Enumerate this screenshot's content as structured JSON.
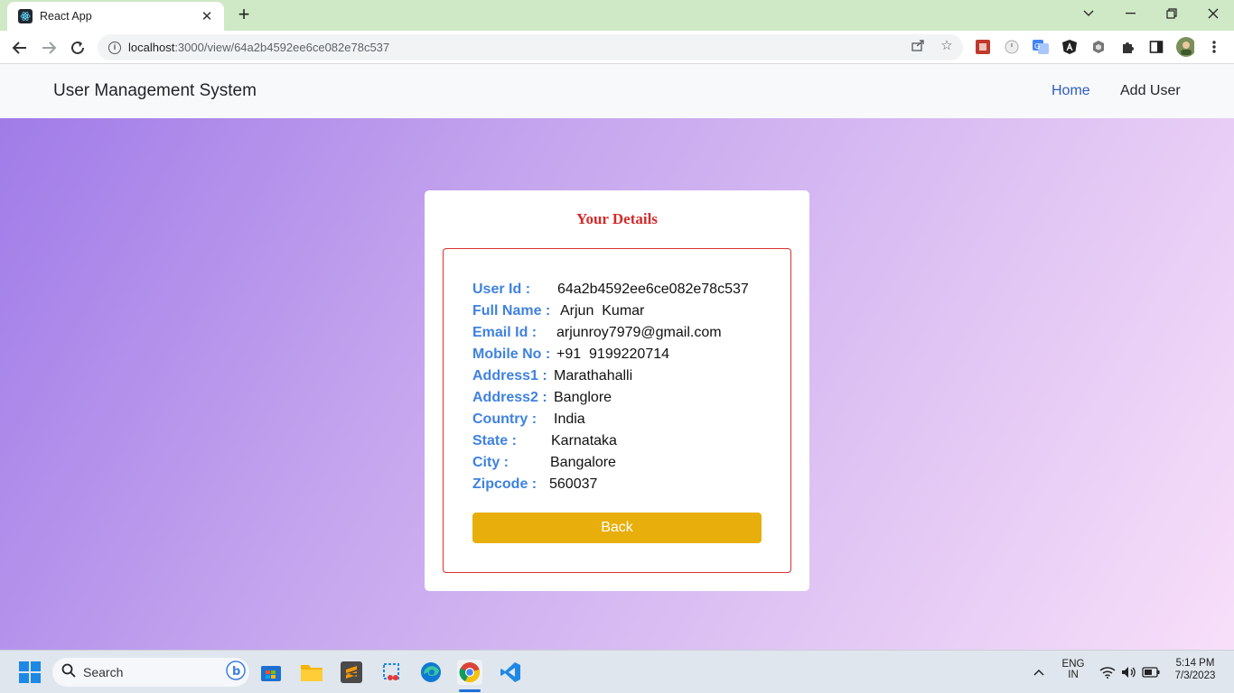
{
  "browser": {
    "tab_title": "React App",
    "url_host": "localhost",
    "url_path": ":3000/view/64a2b4592ee6ce082e78c537"
  },
  "navbar": {
    "brand": "User Management System",
    "links": {
      "home": "Home",
      "add_user": "Add User"
    },
    "active_color": "#2d5bbf"
  },
  "card": {
    "title": "Your Details",
    "fields": [
      {
        "label": "User Id :",
        "value": "64a2b4592ee6ce082e78c537"
      },
      {
        "label": "Full Name :",
        "value": "Arjun  Kumar"
      },
      {
        "label": "Email Id :",
        "value": "arjunroy7979@gmail.com"
      },
      {
        "label": "Mobile No :",
        "value": "+91  9199220714"
      },
      {
        "label": "Address1 :",
        "value": "Marathahalli"
      },
      {
        "label": "Address2 :",
        "value": "Banglore"
      },
      {
        "label": "Country :",
        "value": "India"
      },
      {
        "label": "State :",
        "value": "Karnataka"
      },
      {
        "label": "City :",
        "value": "Bangalore"
      },
      {
        "label": "Zipcode :",
        "value": "560037"
      }
    ],
    "back_label": "Back",
    "label_color": "#3f82e0",
    "accent_color": "#d42a2a",
    "button_color": "#e8af0c"
  },
  "taskbar": {
    "search_placeholder": "Search",
    "lang_top": "ENG",
    "lang_bottom": "IN",
    "time": "5:14 PM",
    "date": "7/3/2023"
  }
}
